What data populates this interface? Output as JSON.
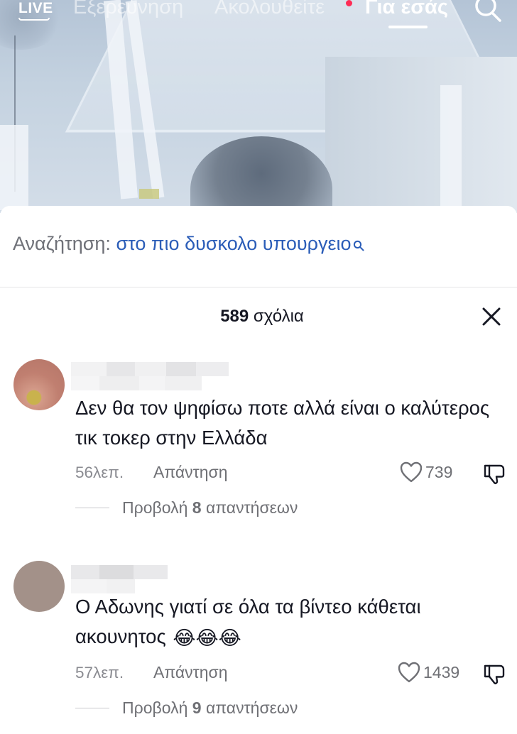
{
  "nav": {
    "live": "LIVE",
    "explore": "Εξερεύνηση",
    "following": "Ακολουθείτε",
    "for_you": "Για εσάς"
  },
  "search_suggestion": {
    "label": "Αναζήτηση:",
    "query": "στο πιο δυσκολο υπουργειο"
  },
  "comments_header": {
    "count": "589",
    "label": "σχόλια"
  },
  "comments": [
    {
      "text": "Δεν θα τον ψηφίσω ποτε αλλά είναι ο καλύτερος τικ τοκερ στην Ελλάδα",
      "time": "56λεπ.",
      "reply": "Απάντηση",
      "likes": "739",
      "view_replies_prefix": "Προβολή",
      "view_replies_count": "8",
      "view_replies_suffix": "απαντήσεων"
    },
    {
      "text": "Ο Αδωνης γιατί σε όλα τα βίντεο κάθεται ακουνητος",
      "emoji": "😂😂😂",
      "time": "57λεπ.",
      "reply": "Απάντηση",
      "likes": "1439",
      "view_replies_prefix": "Προβολή",
      "view_replies_count": "9",
      "view_replies_suffix": "απαντήσεων"
    }
  ],
  "icons": {
    "search": "search-icon",
    "close": "close-icon",
    "heart": "heart-icon",
    "dislike": "thumbs-down-icon"
  }
}
